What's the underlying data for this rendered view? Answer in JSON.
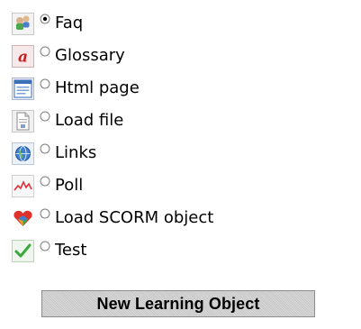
{
  "options": [
    {
      "id": "faq",
      "label": "Faq",
      "icon": "faq-people-icon",
      "selected": true
    },
    {
      "id": "glossary",
      "label": "Glossary",
      "icon": "glossary-letter-icon",
      "selected": false
    },
    {
      "id": "html-page",
      "label": "Html page",
      "icon": "html-page-icon",
      "selected": false
    },
    {
      "id": "load-file",
      "label": "Load file",
      "icon": "load-file-icon",
      "selected": false
    },
    {
      "id": "links",
      "label": "Links",
      "icon": "links-globe-icon",
      "selected": false
    },
    {
      "id": "poll",
      "label": "Poll",
      "icon": "poll-chart-icon",
      "selected": false
    },
    {
      "id": "load-scorm-object",
      "label": "Load SCORM object",
      "icon": "scorm-object-icon",
      "selected": false
    },
    {
      "id": "test",
      "label": "Test",
      "icon": "test-check-icon",
      "selected": false
    }
  ],
  "footer": {
    "new_learning_object_label": "New Learning Object"
  },
  "colors": {
    "selection": "#000000",
    "radio_border": "#7f7f7f",
    "button_bg": "#d5d5d5",
    "button_border": "#8c8c8c"
  }
}
